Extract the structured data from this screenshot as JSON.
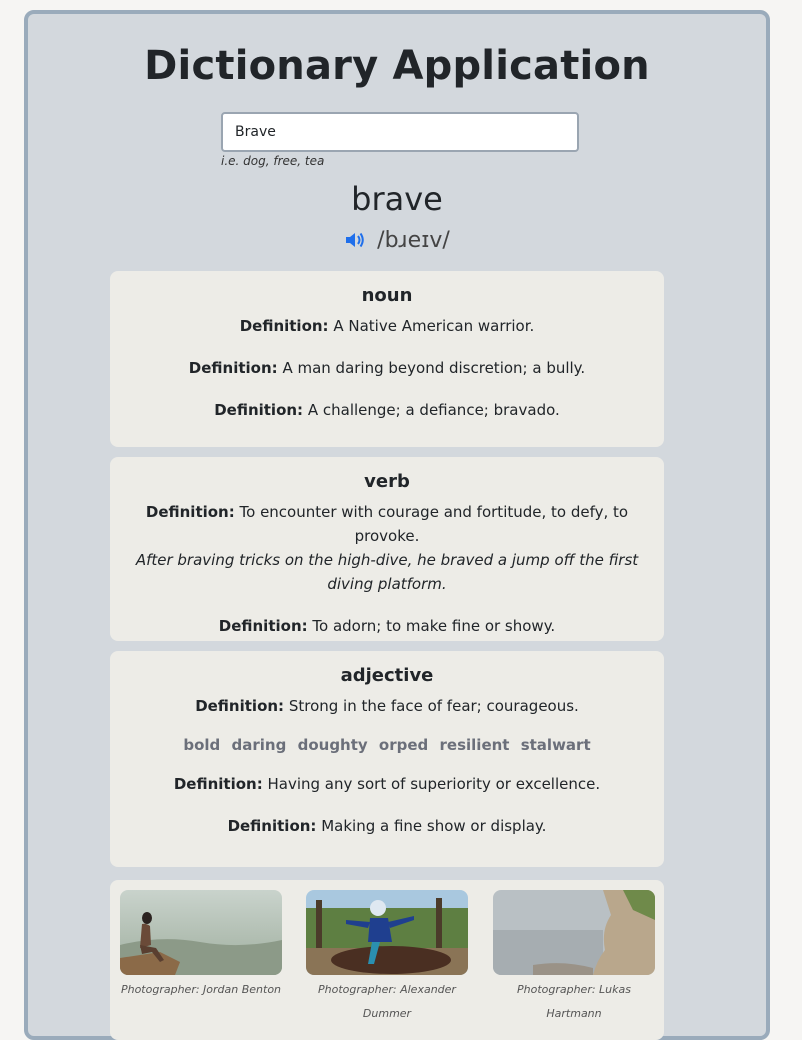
{
  "app": {
    "title": "Dictionary Application"
  },
  "search": {
    "value": "Brave",
    "hint": "i.e. dog, free, tea"
  },
  "entry": {
    "word": "brave",
    "phonetic": "/bɹeɪv/"
  },
  "meanings": [
    {
      "part_of_speech": "noun",
      "definitions": [
        {
          "label": "Definition:",
          "text": "A Native American warrior."
        },
        {
          "label": "Definition:",
          "text": "A man daring beyond discretion; a bully."
        },
        {
          "label": "Definition:",
          "text": "A challenge; a defiance; bravado."
        }
      ]
    },
    {
      "part_of_speech": "verb",
      "definitions": [
        {
          "label": "Definition:",
          "text": "To encounter with courage and fortitude, to defy, to provoke.",
          "example": "After braving tricks on the high-dive, he braved a jump off the first diving platform."
        },
        {
          "label": "Definition:",
          "text": "To adorn; to make fine or showy."
        }
      ]
    },
    {
      "part_of_speech": "adjective",
      "definitions": [
        {
          "label": "Definition:",
          "text": "Strong in the face of fear; courageous."
        },
        {
          "label": "Definition:",
          "text": "Having any sort of superiority or excellence."
        },
        {
          "label": "Definition:",
          "text": "Making a fine show or display."
        }
      ],
      "synonyms": [
        "bold",
        "daring",
        "doughty",
        "orped",
        "resilient",
        "stalwart"
      ]
    }
  ],
  "photos": [
    {
      "credit": "Photographer: Jordan Benton"
    },
    {
      "credit": "Photographer: Alexander Dummer"
    },
    {
      "credit": "Photographer: Lukas Hartmann"
    }
  ],
  "colors": {
    "accent": "#1f6feb",
    "panel": "#d3d8dd",
    "card": "#edece7",
    "border": "#9aabbb"
  }
}
